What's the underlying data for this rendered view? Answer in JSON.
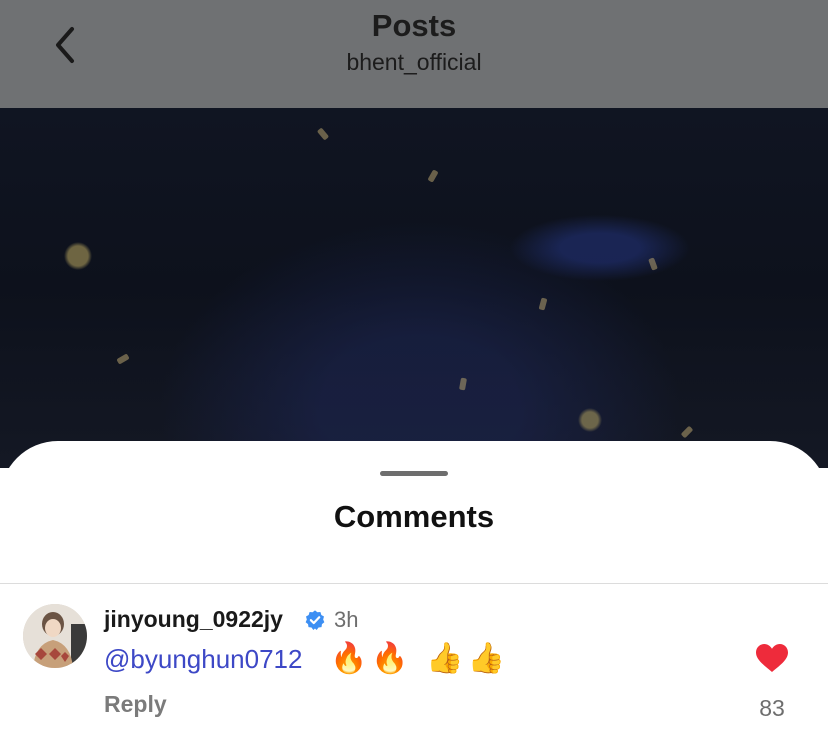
{
  "header": {
    "title": "Posts",
    "subtitle": "bhent_official",
    "back_icon": "chevron-left-icon"
  },
  "sheet": {
    "title": "Comments"
  },
  "comment": {
    "username": "jinyoung_0922jy",
    "verified_icon": "verified-badge-icon",
    "time": "3h",
    "mention": "@byunghun0712",
    "emojis": "🔥🔥 👍👍",
    "reply_label": "Reply",
    "like_count": "83",
    "like_icon": "heart-icon",
    "heart_color": "#ee2b3b"
  }
}
